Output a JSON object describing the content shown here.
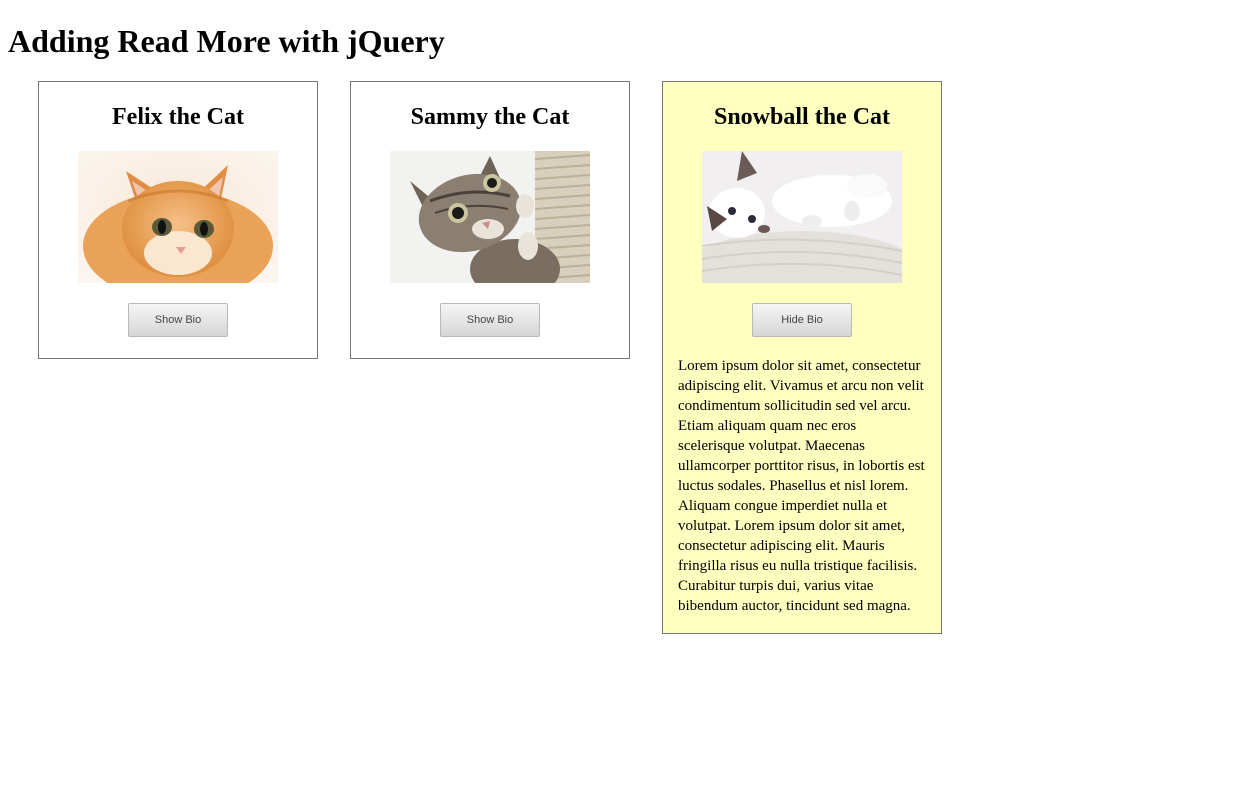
{
  "page": {
    "title": "Adding Read More with jQuery"
  },
  "cards": [
    {
      "name": "Felix the Cat",
      "button_label": "Show Bio",
      "photo_alt": "orange kitten"
    },
    {
      "name": "Sammy the Cat",
      "button_label": "Show Bio",
      "photo_alt": "tabby kitten"
    },
    {
      "name": "Snowball the Cat",
      "button_label": "Hide Bio",
      "photo_alt": "white kitten",
      "bio": "Lorem ipsum dolor sit amet, consectetur adipiscing elit. Vivamus et arcu non velit condimentum sollicitudin sed vel arcu. Etiam aliquam quam nec eros scelerisque volutpat. Maecenas ullamcorper porttitor risus, in lobortis est luctus sodales. Phasellus et nisl lorem. Aliquam congue imperdiet nulla et volutpat. Lorem ipsum dolor sit amet, consectetur adipiscing elit. Mauris fringilla risus eu nulla tristique facilisis. Curabitur turpis dui, varius vitae bibendum auctor, tincidunt sed magna."
    }
  ],
  "colors": {
    "expanded_card_background": "#ffffc0",
    "card_border": "#777777"
  }
}
